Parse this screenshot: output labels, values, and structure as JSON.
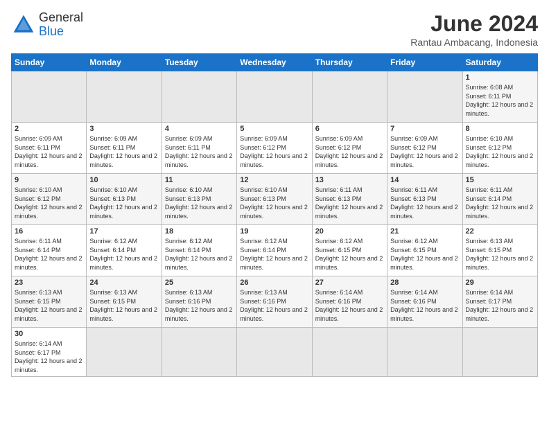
{
  "header": {
    "logo_general": "General",
    "logo_blue": "Blue",
    "month_title": "June 2024",
    "location": "Rantau Ambacang, Indonesia"
  },
  "days_of_week": [
    "Sunday",
    "Monday",
    "Tuesday",
    "Wednesday",
    "Thursday",
    "Friday",
    "Saturday"
  ],
  "weeks": [
    [
      {
        "day": "",
        "info": ""
      },
      {
        "day": "",
        "info": ""
      },
      {
        "day": "",
        "info": ""
      },
      {
        "day": "",
        "info": ""
      },
      {
        "day": "",
        "info": ""
      },
      {
        "day": "",
        "info": ""
      },
      {
        "day": "1",
        "info": "Sunrise: 6:08 AM\nSunset: 6:11 PM\nDaylight: 12 hours and 2 minutes."
      }
    ],
    [
      {
        "day": "2",
        "info": "Sunrise: 6:09 AM\nSunset: 6:11 PM\nDaylight: 12 hours and 2 minutes."
      },
      {
        "day": "3",
        "info": "Sunrise: 6:09 AM\nSunset: 6:11 PM\nDaylight: 12 hours and 2 minutes."
      },
      {
        "day": "4",
        "info": "Sunrise: 6:09 AM\nSunset: 6:11 PM\nDaylight: 12 hours and 2 minutes."
      },
      {
        "day": "5",
        "info": "Sunrise: 6:09 AM\nSunset: 6:12 PM\nDaylight: 12 hours and 2 minutes."
      },
      {
        "day": "6",
        "info": "Sunrise: 6:09 AM\nSunset: 6:12 PM\nDaylight: 12 hours and 2 minutes."
      },
      {
        "day": "7",
        "info": "Sunrise: 6:09 AM\nSunset: 6:12 PM\nDaylight: 12 hours and 2 minutes."
      },
      {
        "day": "8",
        "info": "Sunrise: 6:10 AM\nSunset: 6:12 PM\nDaylight: 12 hours and 2 minutes."
      }
    ],
    [
      {
        "day": "9",
        "info": "Sunrise: 6:10 AM\nSunset: 6:12 PM\nDaylight: 12 hours and 2 minutes."
      },
      {
        "day": "10",
        "info": "Sunrise: 6:10 AM\nSunset: 6:13 PM\nDaylight: 12 hours and 2 minutes."
      },
      {
        "day": "11",
        "info": "Sunrise: 6:10 AM\nSunset: 6:13 PM\nDaylight: 12 hours and 2 minutes."
      },
      {
        "day": "12",
        "info": "Sunrise: 6:10 AM\nSunset: 6:13 PM\nDaylight: 12 hours and 2 minutes."
      },
      {
        "day": "13",
        "info": "Sunrise: 6:11 AM\nSunset: 6:13 PM\nDaylight: 12 hours and 2 minutes."
      },
      {
        "day": "14",
        "info": "Sunrise: 6:11 AM\nSunset: 6:13 PM\nDaylight: 12 hours and 2 minutes."
      },
      {
        "day": "15",
        "info": "Sunrise: 6:11 AM\nSunset: 6:14 PM\nDaylight: 12 hours and 2 minutes."
      }
    ],
    [
      {
        "day": "16",
        "info": "Sunrise: 6:11 AM\nSunset: 6:14 PM\nDaylight: 12 hours and 2 minutes."
      },
      {
        "day": "17",
        "info": "Sunrise: 6:12 AM\nSunset: 6:14 PM\nDaylight: 12 hours and 2 minutes."
      },
      {
        "day": "18",
        "info": "Sunrise: 6:12 AM\nSunset: 6:14 PM\nDaylight: 12 hours and 2 minutes."
      },
      {
        "day": "19",
        "info": "Sunrise: 6:12 AM\nSunset: 6:14 PM\nDaylight: 12 hours and 2 minutes."
      },
      {
        "day": "20",
        "info": "Sunrise: 6:12 AM\nSunset: 6:15 PM\nDaylight: 12 hours and 2 minutes."
      },
      {
        "day": "21",
        "info": "Sunrise: 6:12 AM\nSunset: 6:15 PM\nDaylight: 12 hours and 2 minutes."
      },
      {
        "day": "22",
        "info": "Sunrise: 6:13 AM\nSunset: 6:15 PM\nDaylight: 12 hours and 2 minutes."
      }
    ],
    [
      {
        "day": "23",
        "info": "Sunrise: 6:13 AM\nSunset: 6:15 PM\nDaylight: 12 hours and 2 minutes."
      },
      {
        "day": "24",
        "info": "Sunrise: 6:13 AM\nSunset: 6:15 PM\nDaylight: 12 hours and 2 minutes."
      },
      {
        "day": "25",
        "info": "Sunrise: 6:13 AM\nSunset: 6:16 PM\nDaylight: 12 hours and 2 minutes."
      },
      {
        "day": "26",
        "info": "Sunrise: 6:13 AM\nSunset: 6:16 PM\nDaylight: 12 hours and 2 minutes."
      },
      {
        "day": "27",
        "info": "Sunrise: 6:14 AM\nSunset: 6:16 PM\nDaylight: 12 hours and 2 minutes."
      },
      {
        "day": "28",
        "info": "Sunrise: 6:14 AM\nSunset: 6:16 PM\nDaylight: 12 hours and 2 minutes."
      },
      {
        "day": "29",
        "info": "Sunrise: 6:14 AM\nSunset: 6:17 PM\nDaylight: 12 hours and 2 minutes."
      }
    ],
    [
      {
        "day": "30",
        "info": "Sunrise: 6:14 AM\nSunset: 6:17 PM\nDaylight: 12 hours and 2 minutes."
      },
      {
        "day": "",
        "info": ""
      },
      {
        "day": "",
        "info": ""
      },
      {
        "day": "",
        "info": ""
      },
      {
        "day": "",
        "info": ""
      },
      {
        "day": "",
        "info": ""
      },
      {
        "day": "",
        "info": ""
      }
    ]
  ]
}
